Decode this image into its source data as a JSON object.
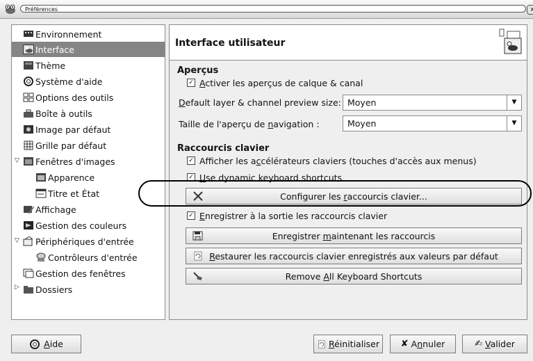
{
  "window": {
    "title": "Préférences",
    "close_glyph": "x"
  },
  "tree": {
    "items": [
      {
        "label": "Environnement",
        "icon": "monitor-chip-icon"
      },
      {
        "label": "Interface",
        "icon": "wilber-icon",
        "selected": true
      },
      {
        "label": "Thème",
        "icon": "theme-icon"
      },
      {
        "label": "Système d'aide",
        "icon": "lifebuoy-icon"
      },
      {
        "label": "Options des outils",
        "icon": "tool-options-icon"
      },
      {
        "label": "Boîte à outils",
        "icon": "toolbox-icon"
      },
      {
        "label": "Image par défaut",
        "icon": "image-icon"
      },
      {
        "label": "Grille par défaut",
        "icon": "grid-icon"
      },
      {
        "label": "Fenêtres d'images",
        "icon": "image-window-icon",
        "expanded": true
      },
      {
        "label": "Apparence",
        "icon": "appearance-icon"
      },
      {
        "label": "Titre et État",
        "icon": "title-status-icon"
      },
      {
        "label": "Affichage",
        "icon": "display-icon"
      },
      {
        "label": "Gestion des couleurs",
        "icon": "color-management-icon"
      },
      {
        "label": "Périphériques d'entrée",
        "icon": "input-devices-icon",
        "expanded": true
      },
      {
        "label": "Contrôleurs d'entrée",
        "icon": "controller-icon"
      },
      {
        "label": "Gestion des fenêtres",
        "icon": "window-management-icon"
      },
      {
        "label": "Dossiers",
        "icon": "folders-icon",
        "collapsed": true
      }
    ]
  },
  "panel": {
    "title": "Interface utilisateur",
    "previews": {
      "section": "Aperçus",
      "enable_previews": {
        "pre": "",
        "u": "A",
        "post": "ctiver les aperçus de calque & canal",
        "checked": true
      },
      "layer_size_label": {
        "pre": "",
        "u": "D",
        "post": "efault layer & channel preview size:"
      },
      "layer_size_value": "Moyen",
      "nav_size_label": {
        "pre": "Taille de l'aperçu de ",
        "u": "n",
        "post": "avigation :"
      },
      "nav_size_value": "Moyen"
    },
    "shortcuts": {
      "section": "Raccourcis clavier",
      "show_accels": {
        "pre": "Afficher les a",
        "u": "c",
        "post": "célérateurs claviers (touches d'accès aux menus)",
        "checked": true
      },
      "dynamic": {
        "pre": "",
        "u": "U",
        "post": "se dynamic keyboard shortcuts",
        "checked": true
      },
      "configure_btn": {
        "pre": "Configurer les ",
        "u": "r",
        "post": "accourcis clavier..."
      },
      "save_on_exit": {
        "pre": "",
        "u": "E",
        "post": "nregistrer à la sortie les raccourcis clavier",
        "checked": true
      },
      "save_now_btn": {
        "pre": "Enregistrer ",
        "u": "m",
        "post": "aintenant les raccourcis"
      },
      "restore_btn": {
        "pre": "",
        "u": "R",
        "post": "estaurer les raccourcis clavier enregistrés aux valeurs par défaut"
      },
      "remove_btn": {
        "pre": "Remove ",
        "u": "A",
        "post": "ll Keyboard Shortcuts"
      }
    }
  },
  "buttons": {
    "help": {
      "pre": "",
      "u": "A",
      "post": "ide"
    },
    "reset": {
      "pre": "",
      "u": "R",
      "post": "éinitialiser"
    },
    "cancel": {
      "pre": "A",
      "u": "n",
      "post": "nuler"
    },
    "ok": {
      "pre": "",
      "u": "V",
      "post": "alider"
    }
  },
  "colors": {
    "selection": "#858585",
    "background": "#efefef"
  }
}
